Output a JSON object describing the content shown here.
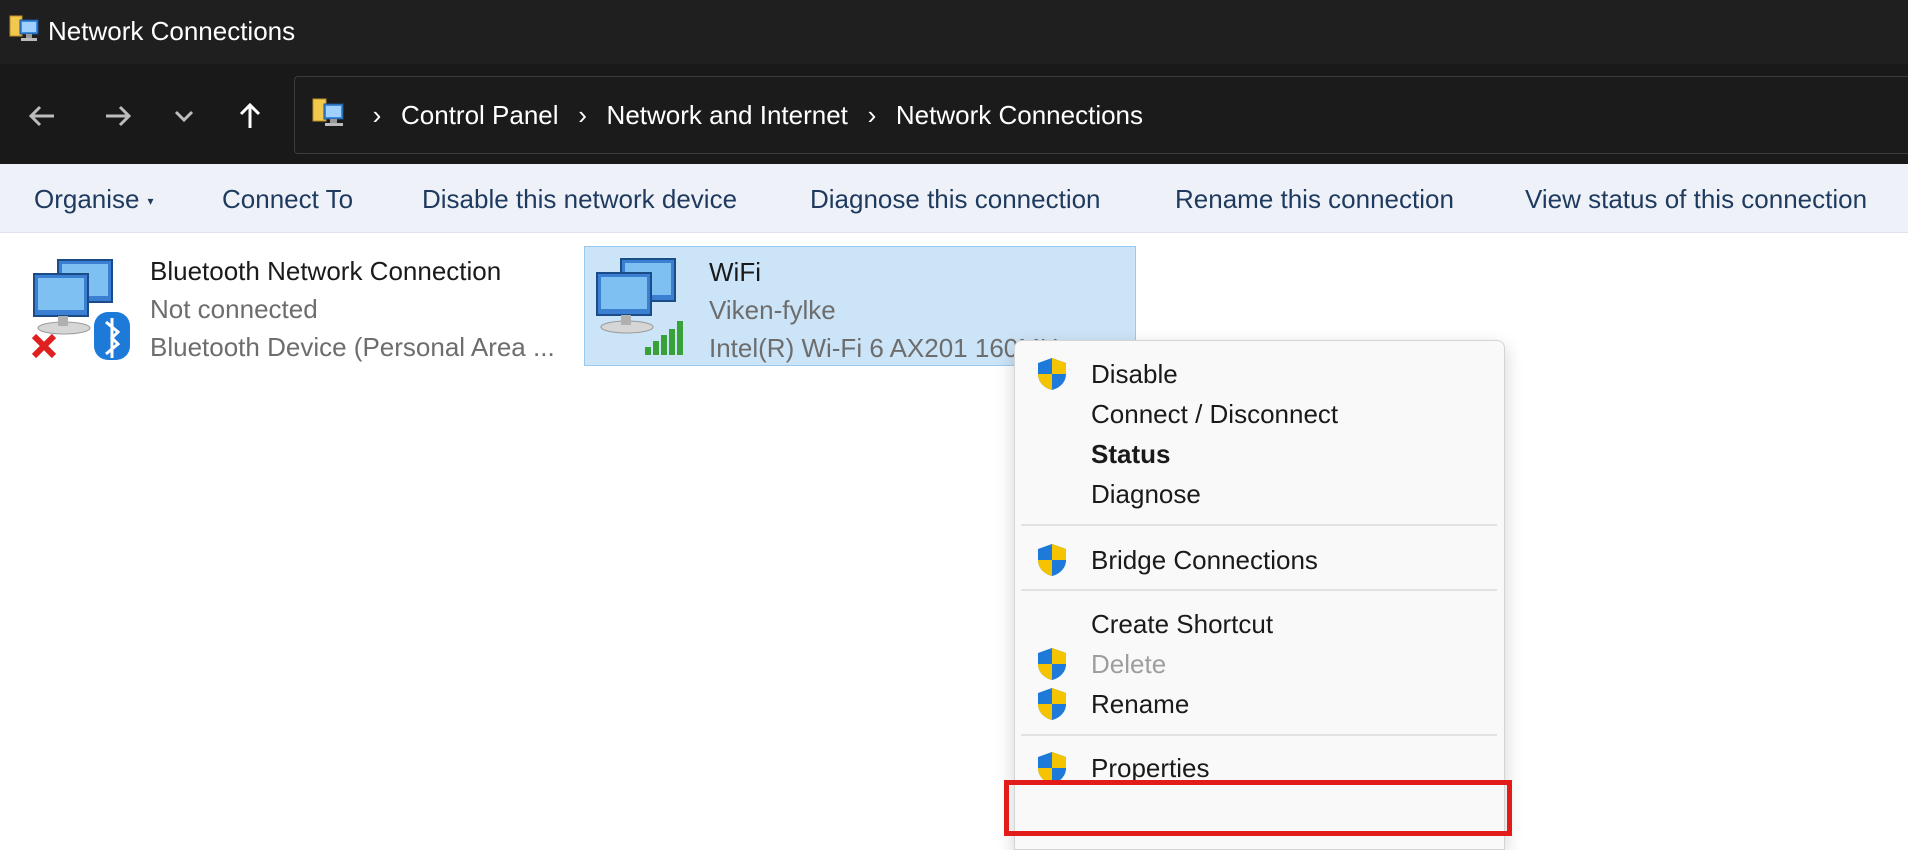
{
  "window": {
    "title": "Network Connections"
  },
  "address": {
    "crumbs": [
      "Control Panel",
      "Network and Internet",
      "Network Connections"
    ]
  },
  "commands": {
    "organise": "Organise",
    "connect_to": "Connect To",
    "disable": "Disable this network device",
    "diagnose": "Diagnose this connection",
    "rename": "Rename this connection",
    "view_status": "View status of this connection"
  },
  "connections": [
    {
      "name": "Bluetooth Network Connection",
      "status": "Not connected",
      "device": "Bluetooth Device (Personal Area ...",
      "icon": "network-bluetooth-disconnected-icon"
    },
    {
      "name": "WiFi",
      "status": "Viken-fylke",
      "device": "Intel(R) Wi-Fi 6 AX201 160MH...",
      "icon": "network-wifi-icon",
      "selected": true
    }
  ],
  "context_menu": {
    "items": [
      {
        "label": "Disable",
        "shield": true
      },
      {
        "label": "Connect / Disconnect",
        "shield": false
      },
      {
        "label": "Status",
        "shield": false,
        "bold": true
      },
      {
        "label": "Diagnose",
        "shield": false
      },
      {
        "label": "Bridge Connections",
        "shield": true
      },
      {
        "label": "Create Shortcut",
        "shield": false
      },
      {
        "label": "Delete",
        "shield": true,
        "disabled": true
      },
      {
        "label": "Rename",
        "shield": true
      },
      {
        "label": "Properties",
        "shield": true,
        "highlighted": true
      }
    ]
  },
  "colors": {
    "titlebar_bg": "#1f1f1f",
    "navbar_bg": "#191919",
    "cmdbar_bg": "#eef2f8",
    "selection_bg": "#cce4f7",
    "highlight_border": "#e41b1b",
    "shield_blue": "#1e7ad9",
    "shield_yellow": "#f5c400"
  }
}
